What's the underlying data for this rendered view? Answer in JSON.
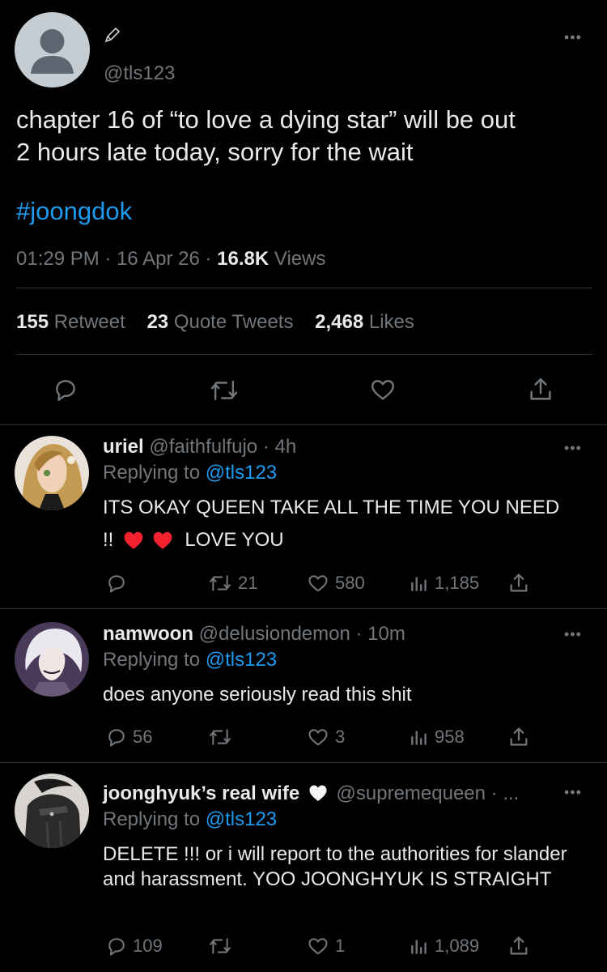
{
  "main_tweet": {
    "handle": "@tls123",
    "text": "chapter 16 of “to love a dying star” will be out\n2 hours late today, sorry for the wait",
    "hashtag": "#joongdok",
    "time": "01:29 PM",
    "date": "16 Apr 26",
    "views_count": "16.8K",
    "views_label": "Views",
    "retweets_count": "155",
    "retweets_label": "Retweet",
    "quotes_count": "23",
    "quotes_label": "Quote Tweets",
    "likes_count": "2,468",
    "likes_label": "Likes",
    "more": "•••"
  },
  "replies": [
    {
      "name": "uriel",
      "handle": "@faithfulfujo",
      "time": "· 4h",
      "replying_label": "Replying to",
      "replying_to": "@tls123",
      "text_line1": "ITS OKAY QUEEN TAKE ALL THE TIME YOU NEED",
      "text_line2_start": "!!",
      "text_line2_end": "LOVE YOU",
      "reply_count": "",
      "retweet_count": "21",
      "like_count": "580",
      "view_count": "1,185"
    },
    {
      "name": "namwoon",
      "handle": "@delusiondemon",
      "time": "· 10m",
      "replying_label": "Replying to",
      "replying_to": "@tls123",
      "text": "does anyone seriously read this shit",
      "reply_count": "56",
      "retweet_count": "",
      "like_count": "3",
      "view_count": "958"
    },
    {
      "name": "joonghyuk’s real wife",
      "handle": "@supremequeen · ...",
      "replying_label": "Replying to",
      "replying_to": "@tls123",
      "text": "DELETE !!! or i will report to the authorities for slander and harassment. YOO JOONGHYUK IS STRAIGHT",
      "reply_count": "109",
      "retweet_count": "",
      "like_count": "1",
      "view_count": "1,089"
    }
  ],
  "colors": {
    "background": "#000000",
    "text": "#e7e9ea",
    "muted": "#71767b",
    "link": "#1d9bf0",
    "divider": "#2f3336",
    "heart_red": "#f4212e"
  },
  "icons": [
    "pen-icon",
    "more-icon",
    "reply-icon",
    "retweet-icon",
    "like-icon",
    "share-icon",
    "views-icon",
    "heart-emoji-icon",
    "white-heart-icon"
  ]
}
